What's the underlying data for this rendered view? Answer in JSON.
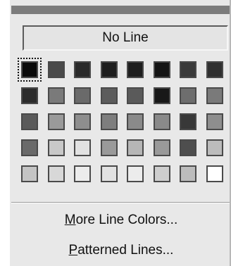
{
  "colors": {
    "panel": "#e8e8e8",
    "title_strip": "#7c7c7c",
    "swatch_border": "#4a4a4a"
  },
  "no_line": {
    "label": "No Line"
  },
  "palette": {
    "selected": "0,0",
    "rows": [
      [
        "#0a0a0a",
        "#4a4a4a",
        "#2a2a2a",
        "#1e1e1e",
        "#1e1e1e",
        "#141414",
        "#3a3a3a",
        "#303030"
      ],
      [
        "#2c2c2c",
        "#7a7a7a",
        "#6a6a6a",
        "#5c5c5c",
        "#5a5a5a",
        "#181818",
        "#6e6e6e",
        "#7a7a7a"
      ],
      [
        "#5a5a5a",
        "#9a9a9a",
        "#8e8e8e",
        "#7e7e7e",
        "#8a8a8a",
        "#8a8a8a",
        "#383838",
        "#8e8e8e"
      ],
      [
        "#6a6a6a",
        "#c8c8c8",
        "#e2e2e2",
        "#9a9a9a",
        "#b6b6b6",
        "#9a9a9a",
        "#4e4e4e",
        "#bcbcbc"
      ],
      [
        "#c4c4c4",
        "#d8d8d8",
        "#ececec",
        "#e2e2e2",
        "#ececec",
        "#cecece",
        "#bcbcbc",
        "#ffffff"
      ]
    ]
  },
  "menu": {
    "more_colors": {
      "accel": "M",
      "rest": "ore Line Colors..."
    },
    "patterned_lines": {
      "accel": "P",
      "rest": "atterned Lines..."
    }
  }
}
